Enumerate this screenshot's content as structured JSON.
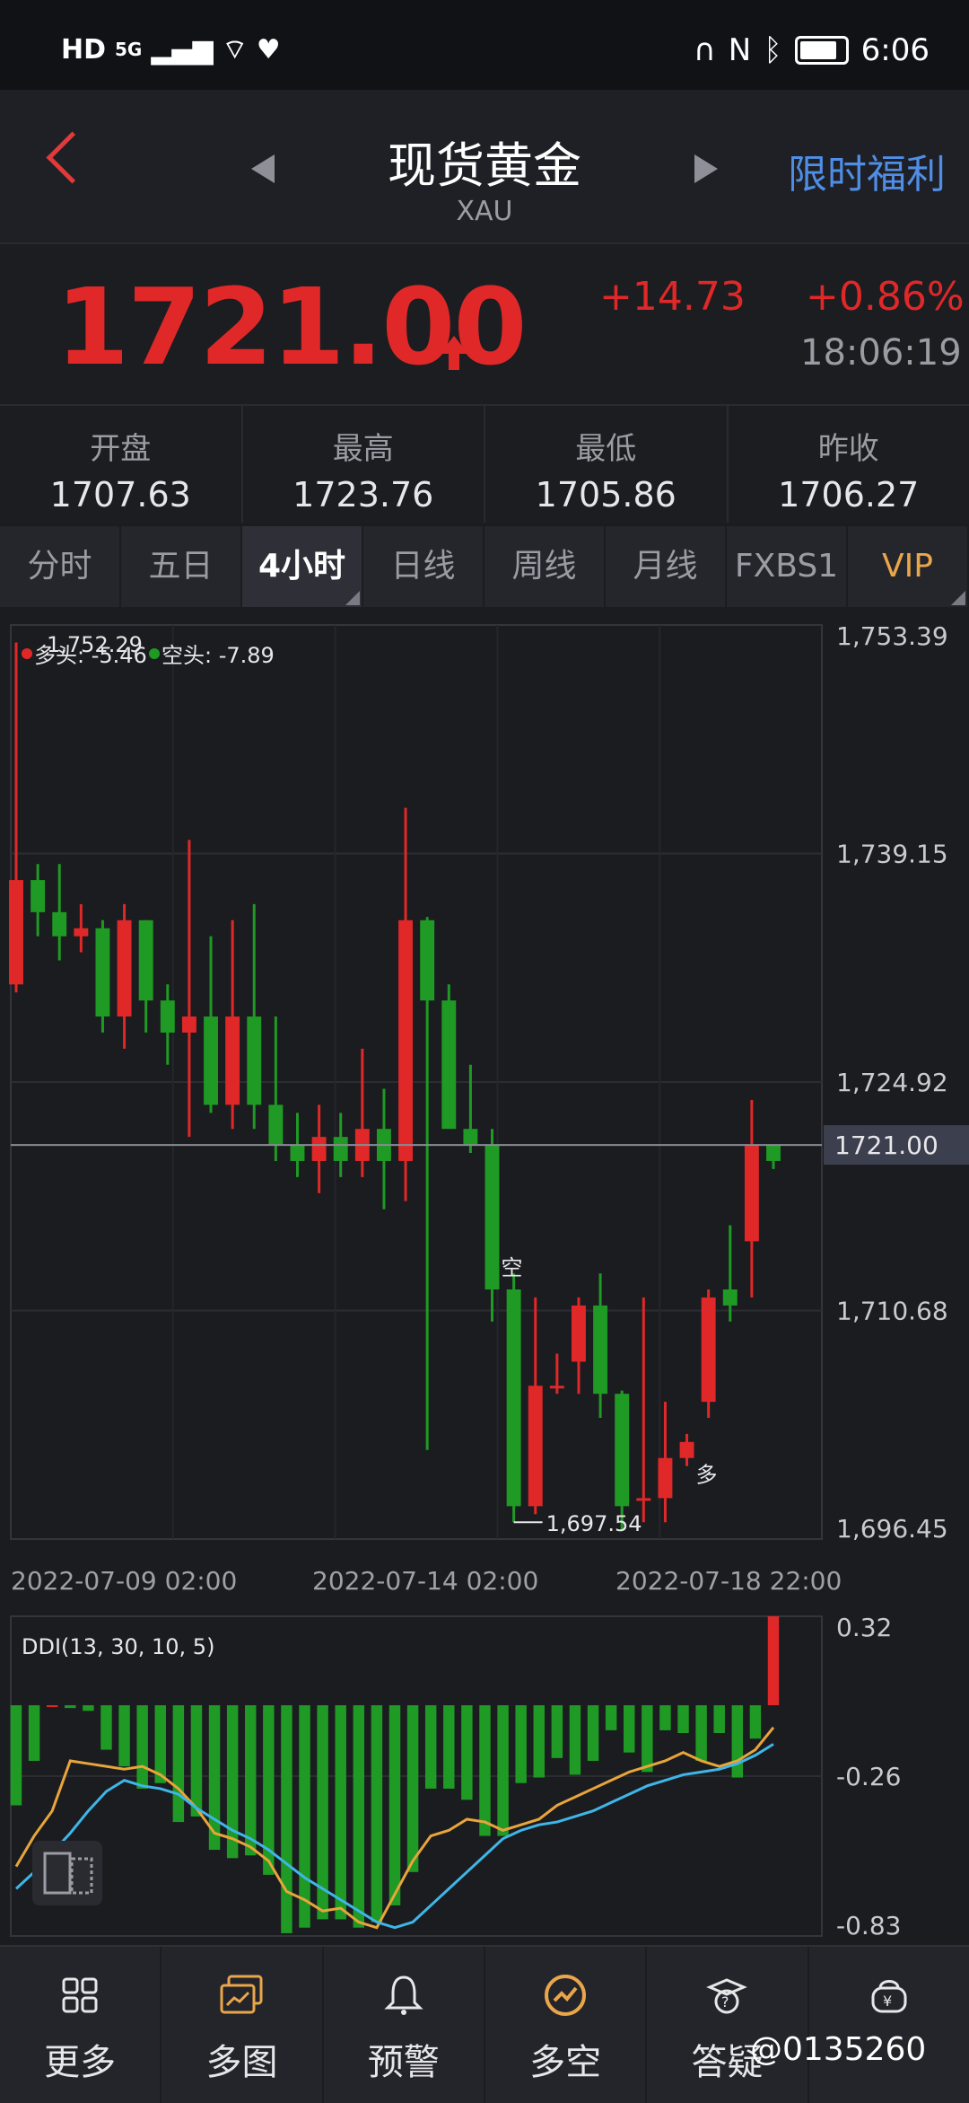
{
  "status": {
    "time": "6:06",
    "left_icons": [
      "HD",
      "5G"
    ]
  },
  "header": {
    "title": "现货黄金",
    "subtitle": "XAU",
    "promo": "限时福利"
  },
  "quote": {
    "price": "1721.00",
    "change": "+14.73",
    "change_pct": "+0.86%",
    "time": "18:06:19"
  },
  "stats": [
    {
      "label": "开盘",
      "value": "1707.63"
    },
    {
      "label": "最高",
      "value": "1723.76"
    },
    {
      "label": "最低",
      "value": "1705.86"
    },
    {
      "label": "昨收",
      "value": "1706.27"
    }
  ],
  "tabs": [
    "分时",
    "五日",
    "4小时",
    "日线",
    "周线",
    "月线",
    "FXBS1",
    "VIP"
  ],
  "active_tab": "4小时",
  "colors": {
    "up": "#e02828",
    "down": "#1f9a24",
    "bg": "#1b1c20",
    "accent": "#4f8ee6",
    "vip": "#e9a64a"
  },
  "chart_data": [
    {
      "type": "candlestick",
      "legend": {
        "long": "多头: -5.46",
        "short": "空头: -7.89"
      },
      "y_ticks": [
        "1,753.39",
        "1,739.15",
        "1,724.92",
        "1,710.68",
        "1,696.45"
      ],
      "ylim": [
        1696.45,
        1753.39
      ],
      "x_ticks": [
        "2022-07-09 02:00",
        "2022-07-14 02:00",
        "2022-07-18 22:00"
      ],
      "current_price_label": "1721.00",
      "current_price": 1721.0,
      "annotations": {
        "high": "1,752.29",
        "low": "1,697.54",
        "sell_mark": "空",
        "buy_mark": "多"
      },
      "candles": [
        [
          1731,
          1737.5,
          1752.3,
          1730.5
        ],
        [
          1737.5,
          1735.5,
          1738.5,
          1734
        ],
        [
          1735.5,
          1734,
          1738.5,
          1732.5
        ],
        [
          1734,
          1734.5,
          1736,
          1733
        ],
        [
          1734.5,
          1729,
          1735,
          1728
        ],
        [
          1729,
          1735,
          1736,
          1727
        ],
        [
          1735,
          1730,
          1735,
          1728
        ],
        [
          1730,
          1728,
          1731,
          1726
        ],
        [
          1728,
          1729,
          1740,
          1721.5
        ],
        [
          1729,
          1723.5,
          1734,
          1723
        ],
        [
          1723.5,
          1729,
          1735,
          1722
        ],
        [
          1729,
          1723.5,
          1736,
          1722
        ],
        [
          1723.5,
          1721,
          1729,
          1720
        ],
        [
          1721,
          1720,
          1723,
          1719
        ],
        [
          1720,
          1721.5,
          1723.5,
          1718
        ],
        [
          1721.5,
          1720,
          1723,
          1719
        ],
        [
          1720,
          1722,
          1727,
          1719
        ],
        [
          1722,
          1720,
          1724.5,
          1717
        ],
        [
          1720,
          1735,
          1742,
          1717.5
        ],
        [
          1735,
          1730,
          1735.2,
          1702
        ],
        [
          1730,
          1722,
          1731,
          1726
        ],
        [
          1722,
          1721,
          1726,
          1720.5
        ],
        [
          1721,
          1712,
          1722,
          1710
        ],
        [
          1712,
          1698.5,
          1713,
          1697.5
        ],
        [
          1698.5,
          1706,
          1711.5,
          1698
        ],
        [
          1706,
          1706,
          1708,
          1705.5
        ],
        [
          1707.5,
          1711,
          1711.5,
          1705.5
        ],
        [
          1711,
          1705.5,
          1713,
          1704
        ],
        [
          1705.5,
          1698.5,
          1705.7,
          1697
        ],
        [
          1699,
          1699,
          1711.5,
          1697.5
        ],
        [
          1699,
          1701.5,
          1705,
          1697.5
        ],
        [
          1701.5,
          1702.5,
          1703,
          1701
        ],
        [
          1705,
          1711.5,
          1712,
          1704
        ],
        [
          1712,
          1711,
          1716,
          1710
        ],
        [
          1715,
          1721,
          1723.8,
          1711.5
        ],
        [
          1721,
          1720,
          1721,
          1719.5
        ]
      ]
    },
    {
      "type": "bar",
      "title": "DDI(13, 30, 10, 5)",
      "y_ticks": [
        "0.32",
        "-0.26",
        "-0.83"
      ],
      "ylim": [
        -0.83,
        0.32
      ],
      "series": [
        {
          "values": [
            -0.36,
            -0.2,
            0.0,
            -0.01,
            -0.02,
            -0.16,
            -0.22,
            -0.3,
            -0.28,
            -0.42,
            -0.4,
            -0.52,
            -0.55,
            -0.54,
            -0.61,
            -0.82,
            -0.8,
            -0.77,
            -0.77,
            -0.8,
            -0.78,
            -0.72,
            -0.6,
            -0.3,
            -0.3,
            -0.34,
            -0.47,
            -0.47,
            -0.28,
            -0.26,
            -0.19,
            -0.25,
            -0.2,
            -0.09,
            -0.17,
            -0.24,
            -0.09,
            -0.1,
            -0.2,
            -0.1,
            -0.26,
            -0.12,
            0.32
          ]
        },
        {
          "values": [
            -0.58,
            -0.47,
            -0.38,
            -0.2,
            -0.21,
            -0.22,
            -0.23,
            -0.22,
            -0.25,
            -0.3,
            -0.37,
            -0.46,
            -0.48,
            -0.51,
            -0.56,
            -0.67,
            -0.7,
            -0.74,
            -0.73,
            -0.78,
            -0.8,
            -0.68,
            -0.56,
            -0.47,
            -0.45,
            -0.41,
            -0.42,
            -0.45,
            -0.43,
            -0.41,
            -0.36,
            -0.33,
            -0.3,
            -0.27,
            -0.24,
            -0.22,
            -0.2,
            -0.17,
            -0.2,
            -0.22,
            -0.2,
            -0.16,
            -0.08
          ]
        },
        {
          "values": [
            -0.66,
            -0.6,
            -0.53,
            -0.46,
            -0.38,
            -0.31,
            -0.27,
            -0.29,
            -0.3,
            -0.32,
            -0.37,
            -0.41,
            -0.45,
            -0.48,
            -0.52,
            -0.57,
            -0.62,
            -0.66,
            -0.7,
            -0.74,
            -0.78,
            -0.8,
            -0.78,
            -0.72,
            -0.66,
            -0.6,
            -0.54,
            -0.48,
            -0.45,
            -0.43,
            -0.42,
            -0.4,
            -0.38,
            -0.35,
            -0.32,
            -0.29,
            -0.27,
            -0.25,
            -0.24,
            -0.23,
            -0.21,
            -0.18,
            -0.14
          ]
        }
      ],
      "colors": [
        "#e02828",
        "#1f9a24",
        "#e8a53a",
        "#3fb6e8"
      ]
    }
  ],
  "nav": [
    {
      "label": "更多",
      "icon": "grid-icon"
    },
    {
      "label": "多图",
      "icon": "multi-chart-icon"
    },
    {
      "label": "预警",
      "icon": "bell-icon"
    },
    {
      "label": "多空",
      "icon": "trend-icon"
    },
    {
      "label": "答疑",
      "icon": "qa-icon"
    },
    {
      "label": "",
      "icon": "piggy-bank-icon"
    }
  ],
  "watermark": "@0135260"
}
